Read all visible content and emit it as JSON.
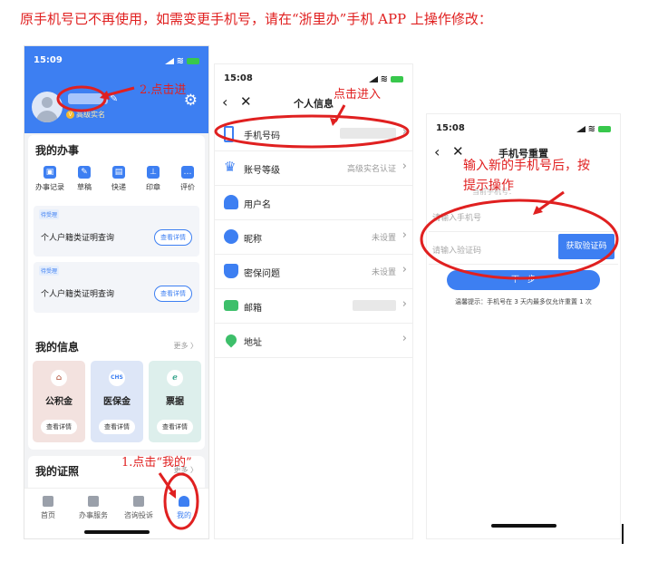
{
  "heading": "原手机号已不再使用，如需变更手机号，请在“浙里办”手机 APP 上操作修改：",
  "colors": {
    "accent": "#3d7ff2",
    "annotation": "#e02020"
  },
  "screen1": {
    "time": "15:09",
    "verify_label": "高级实名",
    "verify_icon": "v-badge-icon",
    "settings_icon": "gear-icon",
    "affairs": {
      "title": "我的办事",
      "services": [
        "办事记录",
        "草稿",
        "快递",
        "印章",
        "评价"
      ],
      "todos": [
        {
          "badge": "待受理",
          "text": "个人户籍类证明查询",
          "button": "查看详情"
        },
        {
          "badge": "待受理",
          "text": "个人户籍类证明查询",
          "button": "查看详情"
        }
      ]
    },
    "info": {
      "title": "我的信息",
      "more": "更多 〉",
      "tiles": [
        {
          "icon_text": "⌂",
          "label": "公积金",
          "button": "查看详情",
          "color": "#f3e2df"
        },
        {
          "icon_text": "CHS",
          "label": "医保金",
          "button": "查看详情",
          "color": "#dde6f7"
        },
        {
          "icon_text": "ℯ",
          "label": "票据",
          "button": "查看详情",
          "color": "#ddefec"
        }
      ]
    },
    "certs": {
      "title": "我的证照",
      "more": "更多 〉"
    },
    "tabs": [
      "首页",
      "办事服务",
      "咨询投诉",
      "我的"
    ]
  },
  "screen2": {
    "time": "15:08",
    "title": "个人信息",
    "rows": [
      {
        "label": "手机号码",
        "value": "",
        "icon": "phone-icon"
      },
      {
        "label": "账号等级",
        "value": "高级实名认证",
        "icon": "crown-icon"
      },
      {
        "label": "用户名",
        "value": "",
        "icon": "user-icon"
      },
      {
        "label": "昵称",
        "value": "未设置",
        "icon": "nickname-icon"
      },
      {
        "label": "密保问题",
        "value": "未设置",
        "icon": "lock-icon"
      },
      {
        "label": "邮箱",
        "value": "",
        "icon": "mail-icon"
      },
      {
        "label": "地址",
        "value": "",
        "icon": "location-icon"
      }
    ]
  },
  "screen3": {
    "time": "15:08",
    "title": "手机号重置",
    "current_phone_label": "当前手机号：",
    "phone_placeholder": "请输入手机号",
    "code_placeholder": "请输入验证码",
    "code_button": "获取验证码",
    "next_button": "下一步",
    "tip": "温馨提示：手机号在 3 天内最多仅允许重置 1 次"
  },
  "annotations": {
    "step1": "1.点击“我的”",
    "step2": "2.点击进",
    "enter": "点击进入",
    "instruction_line1": "输入新的手机号后，按",
    "instruction_line2": "提示操作"
  }
}
